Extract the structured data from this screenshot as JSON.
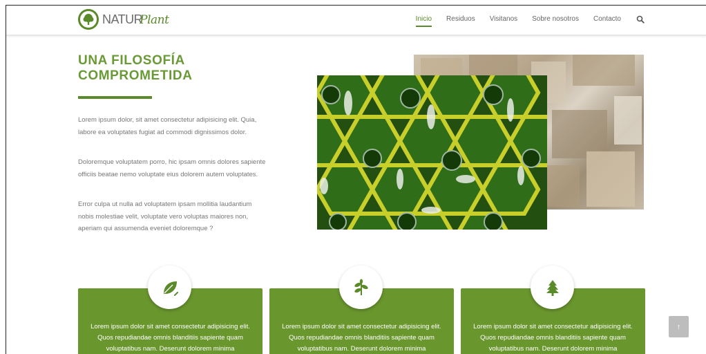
{
  "brand": {
    "logo_text_bold": "NATUR",
    "logo_text_script": "Plant"
  },
  "nav": {
    "items": [
      "Inicio",
      "Residuos",
      "Visitanos",
      "Sobre nosotros",
      "Contacto"
    ],
    "active": "Inicio"
  },
  "hero": {
    "title_line1": "UNA FILOSOFÍA",
    "title_line2": "COMPROMETIDA",
    "paragraphs": [
      "Lorem ipsum dolor, sit amet consectetur adipisicing elit. Quia, labore ea voluptates fugiat ad commodi dignissimos dolor.",
      "Doloremque voluptatem porro, hic ipsam omnis dolores sapiente officiis beatae nemo voluptate eius dolorem autem voluptates.",
      "Error culpa ut nulla ad voluptatem ipsam mollitia laudantium nobis molestiae velit, voluptate vero voluptas maiores non, aperiam qui assumenda eveniet doloremque ?"
    ]
  },
  "features": [
    {
      "icon": "leaf-icon",
      "text": "Lorem ipsum dolor sit amet consectetur adipisicing elit. Quos repudiandae omnis blanditiis sapiente quam voluptatibus nam. Deserunt dolorem minima"
    },
    {
      "icon": "sprout-icon",
      "text": "Lorem ipsum dolor sit amet consectetur adipisicing elit. Quos repudiandae omnis blanditiis sapiente quam voluptatibus nam. Deserunt dolorem minima"
    },
    {
      "icon": "tree-icon",
      "text": "Lorem ipsum dolor sit amet consectetur adipisicing elit. Quos repudiandae omnis blanditiis sapiente quam voluptatibus nam. Deserunt dolorem minima"
    }
  ],
  "colors": {
    "brand_green": "#5a8a2a",
    "card_green": "#6a962e",
    "text_gray": "#777777"
  },
  "scroll_top": {
    "icon": "arrow-up-icon",
    "glyph": "↑"
  }
}
